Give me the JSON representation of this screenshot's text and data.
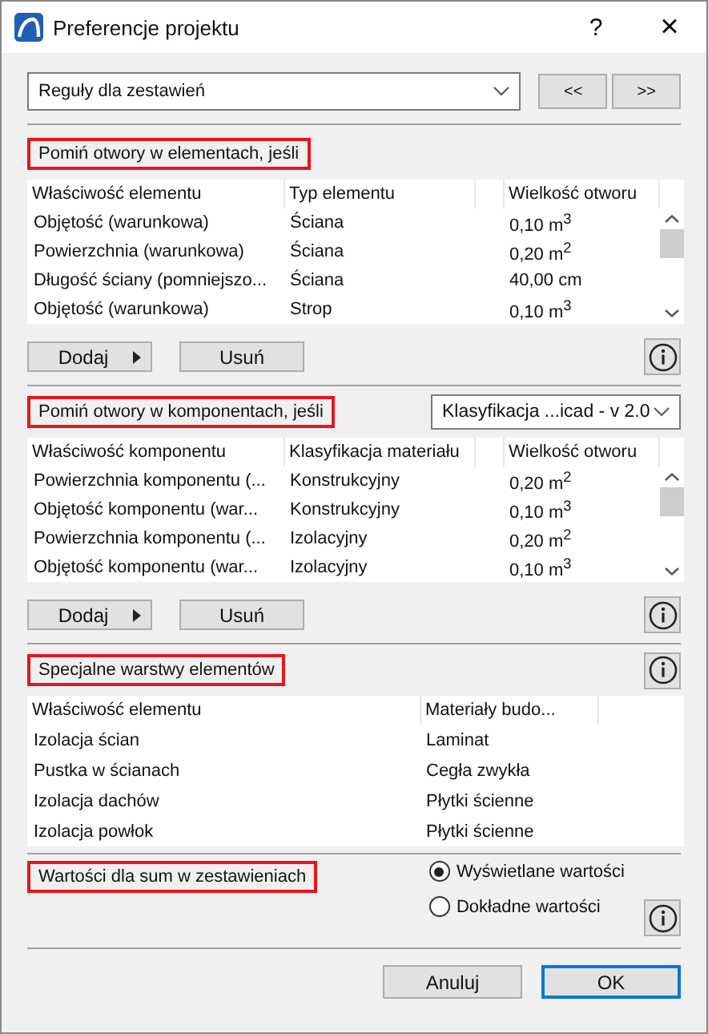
{
  "window": {
    "title": "Preferencje projektu",
    "help": "?",
    "close": "×"
  },
  "top": {
    "dropdown": "Reguły dla zestawień",
    "prev": "<<",
    "next": ">>"
  },
  "section_1": {
    "title": "Pomiń otwory w elementach, jeśli",
    "columns": [
      "Właściwość elementu",
      "Typ elementu",
      "",
      "Wielkość otworu"
    ],
    "rows": [
      [
        "Objętość (warunkowa)",
        "Ściana",
        "",
        "0,10 m$^{3}$"
      ],
      [
        "Powierzchnia (warunkowa)",
        "Ściana",
        "",
        "0,20 m$^{2}$"
      ],
      [
        "Długość ściany (pomniejszo...",
        "Ściana",
        "",
        "40,00 cm"
      ],
      [
        "Objętość (warunkowa)",
        "Strop",
        "",
        "0,10 m$^{3}$"
      ]
    ],
    "add": "Dodaj",
    "remove": "Usuń"
  },
  "section_2": {
    "title": "Pomiń otwory w komponentach, jeśli",
    "dropdown": "Klasyfikacja ...icad - v 2.0",
    "columns": [
      "Właściwość komponentu",
      "Klasyfikacja materiału",
      "",
      "Wielkość otworu"
    ],
    "rows": [
      [
        "Powierzchnia komponentu (...",
        "Konstrukcyjny",
        "",
        "0,20 m$^{2}$"
      ],
      [
        "Objętość komponentu (war...",
        "Konstrukcyjny",
        "",
        "0,10 m$^{3}$"
      ],
      [
        "Powierzchnia komponentu (...",
        "Izolacyjny",
        "",
        "0,20 m$^{2}$"
      ],
      [
        "Objętość komponentu (war...",
        "Izolacyjny",
        "",
        "0,10 m$^{3}$"
      ]
    ],
    "add": "Dodaj",
    "remove": "Usuń"
  },
  "section_3": {
    "title": "Specjalne warstwy elementów",
    "columns": [
      "Właściwość elementu",
      "Materiały budo..."
    ],
    "rows": [
      [
        "Izolacja ścian",
        "Laminat"
      ],
      [
        "Pustka w ścianach",
        "Cegła zwykła"
      ],
      [
        "Izolacja dachów",
        "Płytki ścienne"
      ],
      [
        "Izolacja powłok",
        "Płytki ścienne"
      ]
    ]
  },
  "section_4": {
    "title": "Wartości dla sum w zestawieniach",
    "options": [
      {
        "label": "Wyświetlane wartości",
        "selected": true
      },
      {
        "label": "Dokładne wartości",
        "selected": false
      }
    ]
  },
  "buttons": [
    {
      "label": "Anuluj",
      "default": false
    },
    {
      "label": "OK",
      "default": true
    }
  ]
}
